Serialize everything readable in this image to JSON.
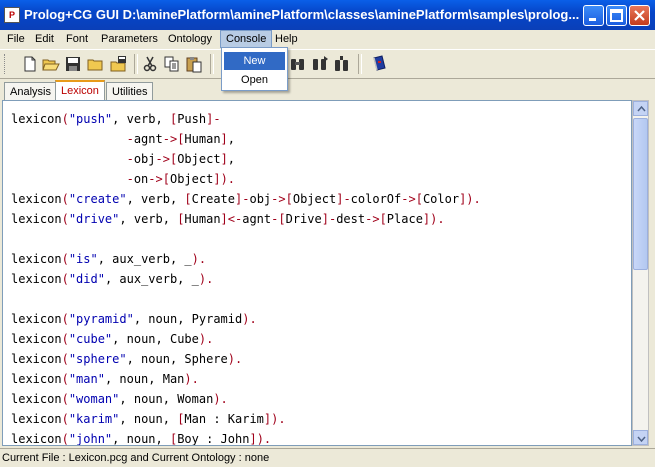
{
  "window": {
    "title": "Prolog+CG GUI D:\\aminePlatform\\aminePlatform\\classes\\aminePlatform\\samples\\prolog..."
  },
  "menubar": {
    "items": [
      {
        "label": "File"
      },
      {
        "label": "Edit"
      },
      {
        "label": "Font"
      },
      {
        "label": "Parameters"
      },
      {
        "label": "Ontology"
      },
      {
        "label": "Console"
      },
      {
        "label": "Help"
      }
    ]
  },
  "console_menu": {
    "items": [
      {
        "label": "New"
      },
      {
        "label": "Open"
      }
    ]
  },
  "tabs": [
    {
      "label": "Analysis"
    },
    {
      "label": "Lexicon"
    },
    {
      "label": "Utilities"
    }
  ],
  "editor": {
    "lines": [
      "lexicon(\"push\", verb, [Push]-",
      "                -agnt->[Human],",
      "                -obj->[Object],",
      "                -on->[Object]).",
      "lexicon(\"create\", verb, [Create]-obj->[Object]-colorOf->[Color]).",
      "lexicon(\"drive\", verb, [Human]<-agnt-[Drive]-dest->[Place]).",
      "",
      "lexicon(\"is\", aux_verb, _).",
      "lexicon(\"did\", aux_verb, _).",
      "",
      "lexicon(\"pyramid\", noun, Pyramid).",
      "lexicon(\"cube\", noun, Cube).",
      "lexicon(\"sphere\", noun, Sphere).",
      "lexicon(\"man\", noun, Man).",
      "lexicon(\"woman\", noun, Woman).",
      "lexicon(\"karim\", noun, [Man : Karim]).",
      "lexicon(\"john\", noun, [Boy : John])."
    ]
  },
  "statusbar": {
    "text": "Current File : Lexicon.pcg and Current Ontology : none"
  },
  "colors": {
    "string": "#0000b0",
    "symbol": "#a0001a",
    "selected_tab": "#b00000",
    "menu_highlight": "#316ac5"
  }
}
